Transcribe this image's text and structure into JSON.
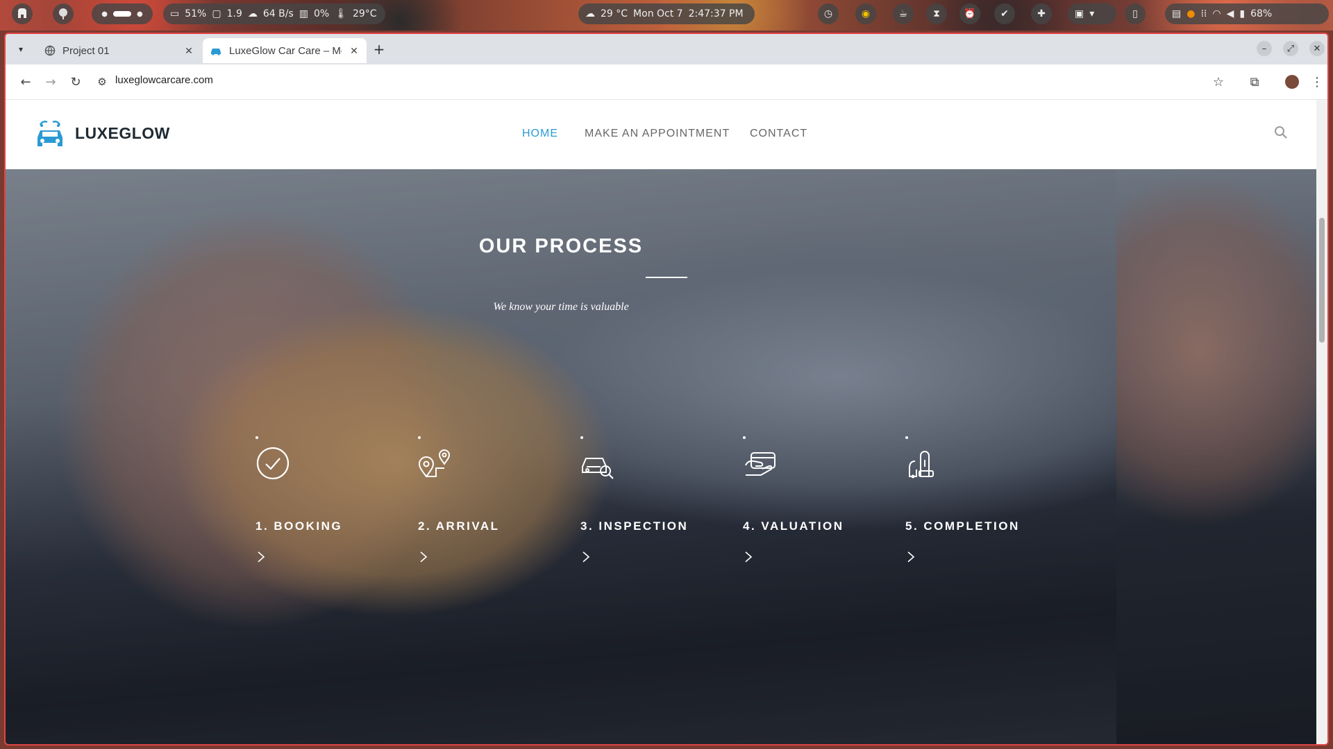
{
  "os_bar": {
    "battery_stat": "51%",
    "load_stat": "1.9",
    "network_stat": "64 B/s",
    "cpu_stat": "0%",
    "temp_stat": "29°C",
    "weather": "29 °C",
    "date": "Mon Oct 7",
    "time": "2:47:37 PM",
    "battery_level": "68%"
  },
  "browser": {
    "tabs": [
      {
        "title": "Project 01",
        "active": false
      },
      {
        "title": "LuxeGlow Car Care – Mo",
        "active": true
      }
    ],
    "new_tab_label": "+",
    "url": "luxeglowcarcare.com"
  },
  "site": {
    "logo_text": "LUXEGLOW",
    "nav": [
      {
        "label": "HOME",
        "active": true
      },
      {
        "label": "MAKE AN APPOINTMENT",
        "active": false
      },
      {
        "label": "CONTACT",
        "active": false
      }
    ],
    "hero": {
      "title": "OUR PROCESS",
      "subtitle": "We know your time is valuable"
    },
    "steps": [
      {
        "label": "1. BOOKING",
        "icon": "check-circle-icon"
      },
      {
        "label": "2. ARRIVAL",
        "icon": "location-pin-icon"
      },
      {
        "label": "3. INSPECTION",
        "icon": "car-search-icon"
      },
      {
        "label": "4. VALUATION",
        "icon": "payment-card-icon"
      },
      {
        "label": "5. COMPLETION",
        "icon": "vacuum-cleaner-icon"
      }
    ]
  },
  "colors": {
    "accent": "#2a9ad4",
    "window_border": "#e04545"
  }
}
